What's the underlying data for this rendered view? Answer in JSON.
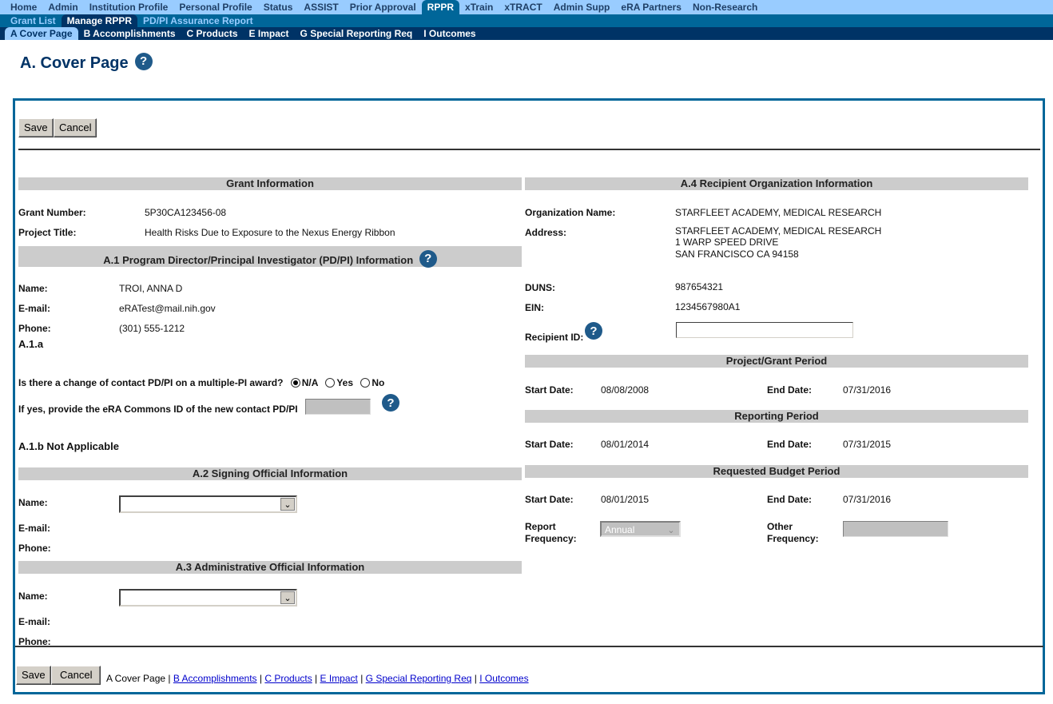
{
  "nav": {
    "top": [
      "Home",
      "Admin",
      "Institution Profile",
      "Personal Profile",
      "Status",
      "ASSIST",
      "Prior Approval",
      "RPPR",
      "xTrain",
      "xTRACT",
      "Admin Supp",
      "eRA Partners",
      "Non-Research"
    ],
    "top_active": "RPPR",
    "second": [
      "Grant List",
      "Manage RPPR",
      "PD/PI Assurance Report"
    ],
    "second_active": "Manage RPPR",
    "third": [
      "A Cover Page",
      "B Accomplishments",
      "C Products",
      "E Impact",
      "G Special Reporting Req",
      "I Outcomes"
    ],
    "third_active": "A Cover Page"
  },
  "page": {
    "title": "A. Cover Page",
    "help_icon": "?"
  },
  "toolbar": {
    "save_label": "Save",
    "cancel_label": "Cancel"
  },
  "grant_info": {
    "heading": "Grant Information",
    "grant_number_label": "Grant Number:",
    "grant_number": "5P30CA123456-08",
    "project_title_label": "Project Title:",
    "project_title": "Health Risks Due to Exposure to the Nexus Energy Ribbon"
  },
  "a1": {
    "heading": "A.1 Program Director/Principal Investigator (PD/PI) Information",
    "name_label": "Name:",
    "name": "TROI, ANNA D",
    "email_label": "E-mail:",
    "email": "eRATest@mail.nih.gov",
    "phone_label": "Phone:",
    "phone": "(301) 555-1212",
    "a1a_label": "A.1.a",
    "change_question": "Is there a change of contact PD/PI on a multiple-PI award?",
    "radio_options": [
      "N/A",
      "Yes",
      "No"
    ],
    "radio_selected": "N/A",
    "commons_id_prompt": "If yes, provide the eRA Commons ID of the new contact PD/PI",
    "commons_id_value": "",
    "a1b_label": "A.1.b Not Applicable"
  },
  "a2": {
    "heading": "A.2 Signing Official Information",
    "name_label": "Name:",
    "name_selected": "",
    "email_label": "E-mail:",
    "phone_label": "Phone:"
  },
  "a3": {
    "heading": "A.3 Administrative Official Information",
    "name_label": "Name:",
    "name_selected": "",
    "email_label": "E-mail:",
    "phone_label": "Phone:"
  },
  "a4": {
    "heading": "A.4 Recipient Organization Information",
    "org_name_label": "Organization Name:",
    "org_name": "STARFLEET ACADEMY, MEDICAL RESEARCH",
    "address_label": "Address:",
    "address_lines": [
      "STARFLEET ACADEMY, MEDICAL RESEARCH",
      "1 WARP SPEED DRIVE",
      "SAN FRANCISCO CA 94158"
    ],
    "duns_label": "DUNS:",
    "duns": "987654321",
    "ein_label": "EIN:",
    "ein": "1234567980A1",
    "recipient_id_label": "Recipient ID:",
    "recipient_id": ""
  },
  "project_period": {
    "heading": "Project/Grant Period",
    "start_label": "Start Date:",
    "start": "08/08/2008",
    "end_label": "End Date:",
    "end": "07/31/2016"
  },
  "reporting_period": {
    "heading": "Reporting Period",
    "start_label": "Start Date:",
    "start": "08/01/2014",
    "end_label": "End Date:",
    "end": "07/31/2015"
  },
  "budget_period": {
    "heading": "Requested Budget Period",
    "start_label": "Start Date:",
    "start": "08/01/2015",
    "end_label": "End Date:",
    "end": "07/31/2016",
    "report_freq_label_1": "Report",
    "report_freq_label_2": "Frequency:",
    "report_freq_value": "Annual",
    "other_freq_label_1": "Other",
    "other_freq_label_2": "Frequency:",
    "other_freq_value": ""
  },
  "footer": {
    "current": "A Cover Page",
    "links": [
      "B Accomplishments",
      "C Products",
      "E Impact",
      "G Special Reporting Req",
      "I Outcomes"
    ],
    "separator": " | "
  }
}
